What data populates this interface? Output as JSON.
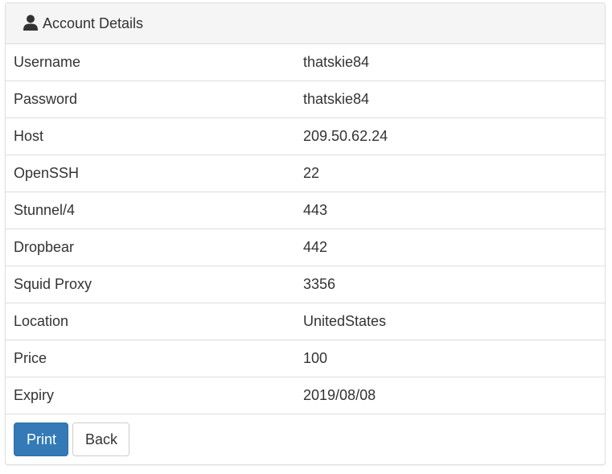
{
  "panel": {
    "title": "Account Details",
    "icon": "user-icon"
  },
  "details": [
    {
      "label": "Username",
      "value": "thatskie84"
    },
    {
      "label": "Password",
      "value": "thatskie84"
    },
    {
      "label": "Host",
      "value": "209.50.62.24"
    },
    {
      "label": "OpenSSH",
      "value": "22"
    },
    {
      "label": "Stunnel/4",
      "value": "443"
    },
    {
      "label": "Dropbear",
      "value": "442"
    },
    {
      "label": "Squid Proxy",
      "value": "3356"
    },
    {
      "label": "Location",
      "value": "UnitedStates"
    },
    {
      "label": "Price",
      "value": "100"
    },
    {
      "label": "Expiry",
      "value": "2019/08/08"
    }
  ],
  "actions": {
    "print_label": "Print",
    "back_label": "Back"
  },
  "colors": {
    "primary": "#337ab7",
    "heading_bg": "#f5f5f5",
    "border": "#dddddd",
    "text": "#333333"
  }
}
